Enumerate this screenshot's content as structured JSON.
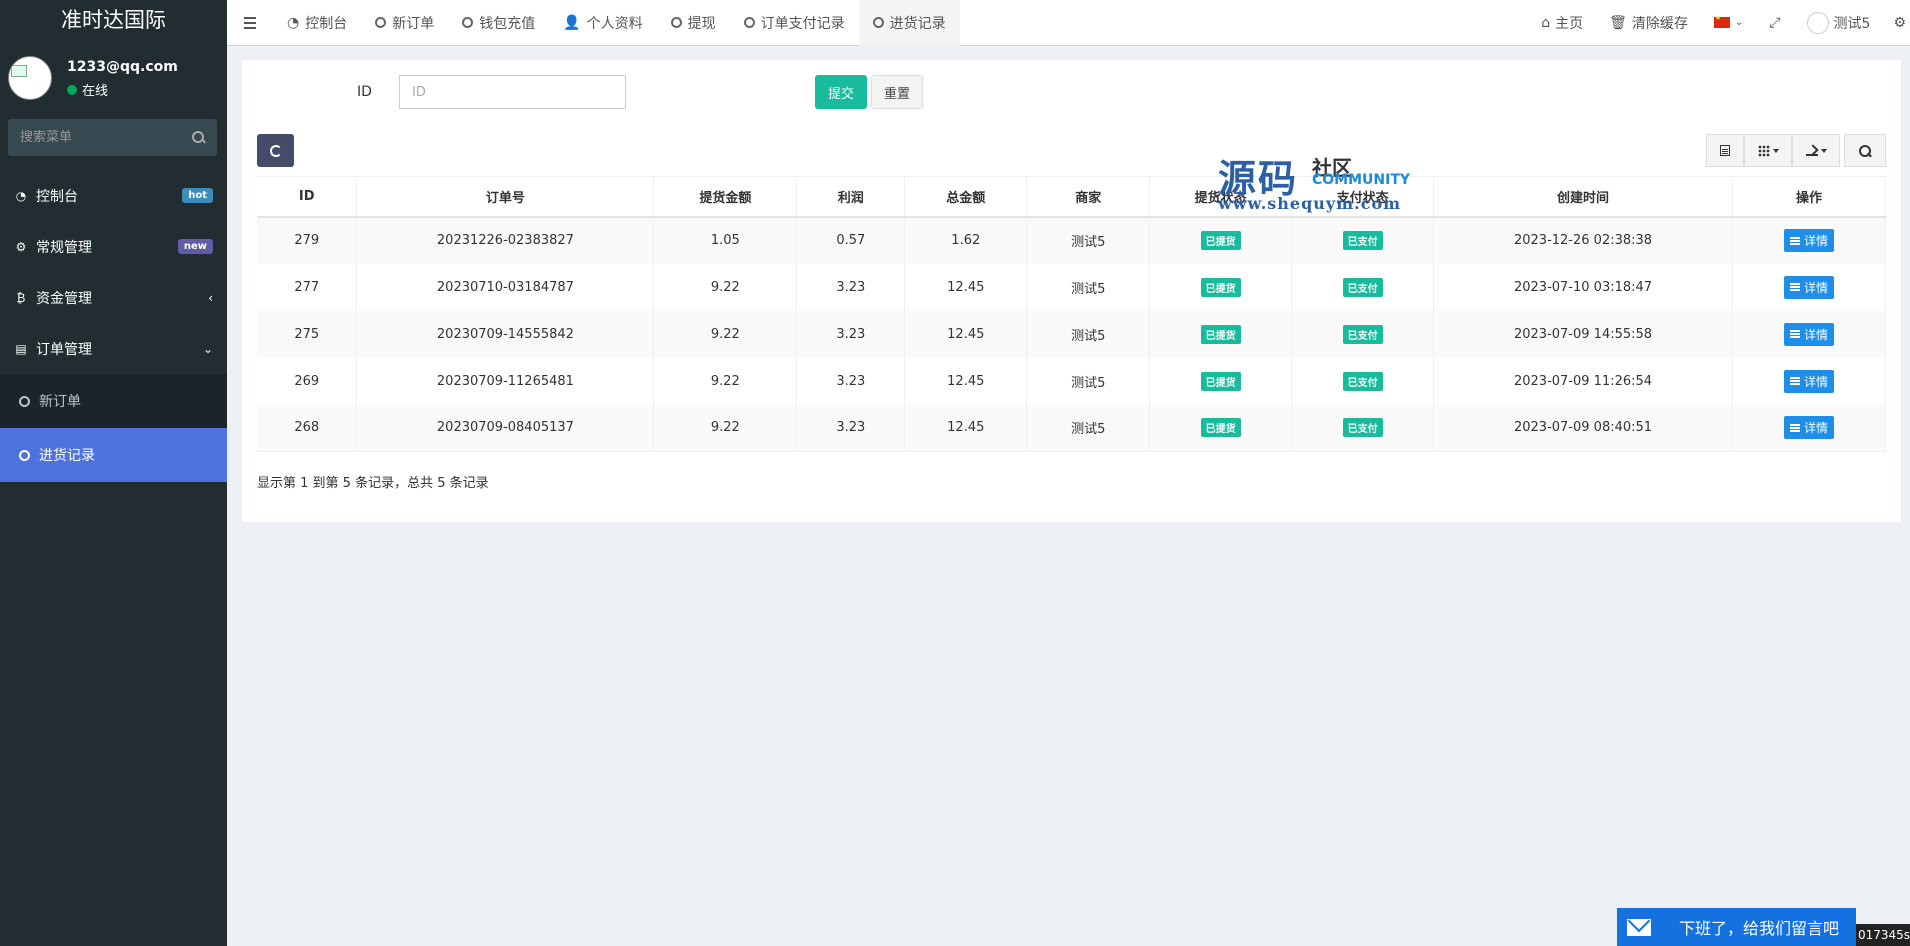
{
  "app": {
    "title": "准时达国际"
  },
  "user": {
    "email": "1233@qq.com",
    "status": "在线"
  },
  "sidebar": {
    "search_placeholder": "搜索菜单",
    "items": [
      {
        "label": "控制台",
        "badge": "hot",
        "icon": "dashboard-icon"
      },
      {
        "label": "常规管理",
        "badge": "new",
        "icon": "cogs-icon"
      },
      {
        "label": "资金管理",
        "icon": "bitcoin-icon",
        "chevron": "‹"
      },
      {
        "label": "订单管理",
        "icon": "list-alt-icon",
        "chevron": "⌄"
      }
    ],
    "sub_items": [
      {
        "label": "新订单",
        "active": false
      },
      {
        "label": "进货记录",
        "active": true
      }
    ]
  },
  "topbar": {
    "tabs": [
      {
        "label": "控制台",
        "icon": "dashboard-icon"
      },
      {
        "label": "新订单",
        "icon": "circle-icon"
      },
      {
        "label": "钱包充值",
        "icon": "circle-icon"
      },
      {
        "label": "个人资料",
        "icon": "user-icon"
      },
      {
        "label": "提现",
        "icon": "circle-icon"
      },
      {
        "label": "订单支付记录",
        "icon": "circle-icon"
      },
      {
        "label": "进货记录",
        "icon": "circle-icon",
        "active": true
      }
    ],
    "home": "主页",
    "clear_cache": "清除缓存",
    "username": "测试5"
  },
  "form": {
    "id_label": "ID",
    "id_placeholder": "ID",
    "submit": "提交",
    "reset": "重置"
  },
  "table": {
    "columns": [
      "ID",
      "订单号",
      "提货金额",
      "利润",
      "总金额",
      "商家",
      "提货状态",
      "支付状态",
      "创建时间",
      "操作"
    ],
    "rows": [
      {
        "id": "279",
        "order_no": "20231226-02383827",
        "pickup_amount": "1.05",
        "profit": "0.57",
        "total": "1.62",
        "merchant": "测试5",
        "pickup_status": "已提货",
        "pay_status": "已支付",
        "created": "2023-12-26 02:38:38",
        "action": "详情"
      },
      {
        "id": "277",
        "order_no": "20230710-03184787",
        "pickup_amount": "9.22",
        "profit": "3.23",
        "total": "12.45",
        "merchant": "测试5",
        "pickup_status": "已提货",
        "pay_status": "已支付",
        "created": "2023-07-10 03:18:47",
        "action": "详情"
      },
      {
        "id": "275",
        "order_no": "20230709-14555842",
        "pickup_amount": "9.22",
        "profit": "3.23",
        "total": "12.45",
        "merchant": "测试5",
        "pickup_status": "已提货",
        "pay_status": "已支付",
        "created": "2023-07-09 14:55:58",
        "action": "详情"
      },
      {
        "id": "269",
        "order_no": "20230709-11265481",
        "pickup_amount": "9.22",
        "profit": "3.23",
        "total": "12.45",
        "merchant": "测试5",
        "pickup_status": "已提货",
        "pay_status": "已支付",
        "created": "2023-07-09 11:26:54",
        "action": "详情"
      },
      {
        "id": "268",
        "order_no": "20230709-08405137",
        "pickup_amount": "9.22",
        "profit": "3.23",
        "total": "12.45",
        "merchant": "测试5",
        "pickup_status": "已提货",
        "pay_status": "已支付",
        "created": "2023-07-09 08:40:51",
        "action": "详情"
      }
    ]
  },
  "pagination_info": "显示第 1 到第 5 条记录，总共 5 条记录",
  "watermark": {
    "big": "源码",
    "cn": "社区",
    "en": "COMMUNITY",
    "url": "www.shequym.com"
  },
  "chat_widget": {
    "text": "下班了，给我们留言吧"
  },
  "corner_text": "017345s",
  "colors": {
    "sidebar_bg": "#222d32",
    "active_sub": "#4e73df",
    "success": "#18bc9c",
    "primary": "#1e8ee9",
    "chat": "#1570e0"
  }
}
